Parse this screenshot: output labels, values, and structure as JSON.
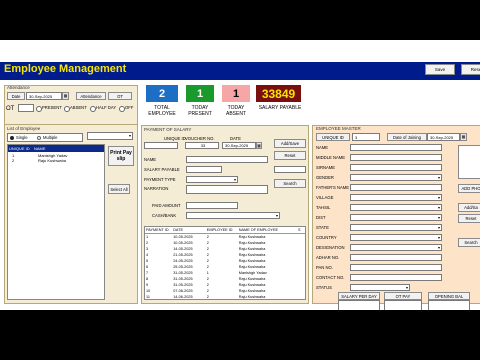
{
  "app": {
    "title": "Employee Management",
    "save_label": "Save",
    "reset_label": "Rese"
  },
  "attendance": {
    "section_label": "Attendance",
    "date_label": "Date",
    "date_value": "30-Sep-2025",
    "attendance_button": "Attendance",
    "ot_button": "OT",
    "ot_label": "OT",
    "options": [
      "PRESENT",
      "ABSENT",
      "HALF DAY",
      "OFF"
    ]
  },
  "employee_list": {
    "section_label": "List of Employee",
    "single_label": "Single",
    "multiple_label": "Multiple",
    "columns": [
      "UNIQUE ID",
      "NAME"
    ],
    "rows": [
      {
        "id": "1",
        "name": "Manishgh Yadav"
      },
      {
        "id": "2",
        "name": "Raju Kushwaha"
      }
    ],
    "print_button": "Print Pay slip",
    "select_all_button": "Select All"
  },
  "stats": [
    {
      "value": "2",
      "label": "TOTAL EMPLOYEE",
      "color": "#1c6fc4"
    },
    {
      "value": "1",
      "label": "TODAY PRESENT",
      "color": "#1a9a2c"
    },
    {
      "value": "1",
      "label": "TODAY ABSENT",
      "color": "#f6a6a6"
    },
    {
      "value": "33849",
      "label": "SALARY PAYABLE",
      "color": "#7a0f0f"
    }
  ],
  "payment": {
    "section_label": "PAYMENT OF SALARY",
    "unique_id_label": "UNIQUE ID",
    "voucher_label": "VOUCHER NO.",
    "voucher_value": "33",
    "date_label": "DATE",
    "date_value": "30-Sep-2025",
    "name_label": "NAME",
    "salary_payable_label": "SALARY PAYABLE",
    "payment_type_label": "PAYMENT TYPE",
    "narration_label": "NARRATION",
    "paid_amount_label": "PAID AMOUNT",
    "cash_bank_label": "CASH/BANK",
    "add_save_button": "Add/Save",
    "reset_button": "Reset",
    "search_button": "Search",
    "columns": [
      "PAYMENT ID",
      "DATE",
      "EMPLOYEE ID",
      "NAME OF EMPLOYEE",
      "S"
    ],
    "rows": [
      {
        "pid": "1",
        "date": "10-05-2025",
        "eid": "2",
        "name": "Raju Kushwaha"
      },
      {
        "pid": "2",
        "date": "10-05-2025",
        "eid": "2",
        "name": "Raju Kushwaha"
      },
      {
        "pid": "3",
        "date": "14-05-2025",
        "eid": "2",
        "name": "Raju Kushwaha"
      },
      {
        "pid": "4",
        "date": "21-05-2025",
        "eid": "2",
        "name": "Raju Kushwaha"
      },
      {
        "pid": "5",
        "date": "24-05-2025",
        "eid": "2",
        "name": "Raju Kushwaha"
      },
      {
        "pid": "6",
        "date": "25-05-2025",
        "eid": "2",
        "name": "Raju Kushwaha"
      },
      {
        "pid": "7",
        "date": "31-05-2025",
        "eid": "1",
        "name": "Manishgh Yadav"
      },
      {
        "pid": "8",
        "date": "31-05-2025",
        "eid": "2",
        "name": "Raju Kushwaha"
      },
      {
        "pid": "9",
        "date": "31-05-2025",
        "eid": "2",
        "name": "Raju Kushwaha"
      },
      {
        "pid": "10",
        "date": "07-06-2025",
        "eid": "2",
        "name": "Raju Kushwaha"
      },
      {
        "pid": "11",
        "date": "14-06-2025",
        "eid": "2",
        "name": "Raju Kushwaha"
      },
      {
        "pid": "12",
        "date": "14-06-2025",
        "eid": "2",
        "name": "Raju Kushwaha"
      }
    ]
  },
  "master": {
    "section_label": "EMPLOYEE MASTER",
    "unique_id_label": "UNIQUE ID",
    "unique_id_value": "3",
    "doj_label": "Date of Joining",
    "doj_value": "30-Sep-2025",
    "fields": [
      "NAME",
      "MIDDLE NAME",
      "SIRNAME",
      "GENDER",
      "FATHER'S NAME",
      "VILLAGE",
      "TAHSIL",
      "DIST",
      "STATE",
      "COUNTRY",
      "DESIGNATION",
      "ADHAR NO.",
      "PAN NO.",
      "CONTACT NO.",
      "STATUS"
    ],
    "salary_per_day_label": "SALARY PER DAY",
    "ot_pay_label": "OT PAY",
    "opening_bal_label": "OPENING BAL",
    "add_photo_button": "ADD PHO",
    "add_save_button": "Add/Sa",
    "reset_button": "Reset",
    "search_button": "Search"
  }
}
